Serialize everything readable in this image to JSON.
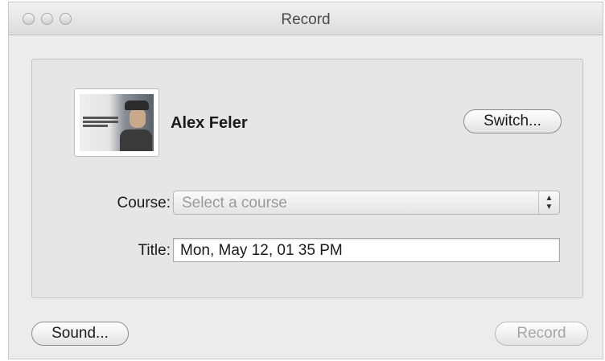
{
  "window": {
    "title": "Record"
  },
  "user": {
    "name": "Alex Feler"
  },
  "buttons": {
    "switch": "Switch...",
    "sound": "Sound...",
    "record": "Record"
  },
  "form": {
    "course_label": "Course:",
    "course_placeholder": "Select a course",
    "title_label": "Title:",
    "title_value": "Mon, May 12, 01 35 PM"
  }
}
